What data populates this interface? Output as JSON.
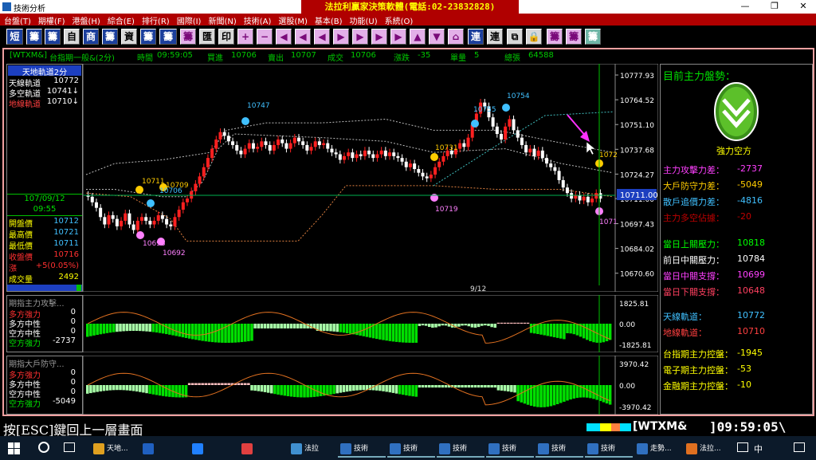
{
  "window": {
    "title": "技術分析",
    "banner": "法拉利贏家決策軟體(電話:02-23832828)",
    "min": "—",
    "restore": "❐",
    "close": "✕"
  },
  "menu": [
    "台盤(T)",
    "期權(F)",
    "港盤(H)",
    "綜合(E)",
    "排行(R)",
    "國際(I)",
    "新聞(N)",
    "技術(A)",
    "選股(M)",
    "基本(B)",
    "功能(U)",
    "系統(O)"
  ],
  "toolbar": {
    "buttons": [
      {
        "label": "短",
        "style": "b"
      },
      {
        "label": "籌",
        "style": "b"
      },
      {
        "label": "籌",
        "style": "b"
      },
      {
        "label": "自",
        "style": ""
      },
      {
        "label": "商",
        "style": "b"
      },
      {
        "label": "籌",
        "style": "b"
      },
      {
        "label": "資",
        "style": ""
      },
      {
        "label": "籌",
        "style": "b"
      },
      {
        "label": "籌",
        "style": "b"
      },
      {
        "label": "籌",
        "style": "p"
      },
      {
        "label": "匯",
        "style": ""
      },
      {
        "label": "印",
        "style": ""
      },
      {
        "label": "+",
        "style": "p"
      },
      {
        "label": "−",
        "style": "p"
      },
      {
        "label": "◀",
        "style": "p"
      },
      {
        "label": "◀",
        "style": "p"
      },
      {
        "label": "◀",
        "style": "p"
      },
      {
        "label": "▶",
        "style": "p"
      },
      {
        "label": "▶",
        "style": "p"
      },
      {
        "label": "▶",
        "style": "p"
      },
      {
        "label": "▶",
        "style": "p"
      },
      {
        "label": "▲",
        "style": "p"
      },
      {
        "label": "▼",
        "style": "p"
      },
      {
        "label": "⌂",
        "style": "p"
      },
      {
        "label": "連",
        "style": "b"
      },
      {
        "label": "連",
        "style": ""
      },
      {
        "label": "⧉",
        "style": ""
      },
      {
        "label": "🔒",
        "style": ""
      },
      {
        "label": "籌",
        "style": "p"
      },
      {
        "label": "籌",
        "style": "p"
      },
      {
        "label": "籌",
        "style": "t"
      }
    ]
  },
  "infobar": {
    "symbol": "[WTXM&]",
    "contract": "台指期一般&(2分)",
    "time_label": "時間",
    "time": "09:59:05",
    "bid_label": "買進",
    "bid": "10706",
    "ask_label": "賣出",
    "ask": "10707",
    "deal_label": "成交",
    "deal": "10706",
    "change_label": "漲跌",
    "change": "-35",
    "vol_label": "單量",
    "vol": "5",
    "total_label": "總張",
    "total": "64588"
  },
  "left_panel": {
    "header": "天地軌道2分",
    "tracks": [
      {
        "label": "天線軌道",
        "value": "10772",
        "color": "#ffffff"
      },
      {
        "label": "多空軌道",
        "value": "10741↓",
        "color": "#ffffff"
      },
      {
        "label": "地線軌道",
        "value": "10710↓",
        "color": "#ff4040"
      }
    ],
    "date": "107/09/12",
    "time": "09:55",
    "stats": [
      {
        "label": "開盤價",
        "value": "10712",
        "color": "#ffff00"
      },
      {
        "label": "最高價",
        "value": "10721",
        "color": "#ffff00"
      },
      {
        "label": "最低價",
        "value": "10711",
        "color": "#ffff00"
      },
      {
        "label": "收盤價",
        "value": "10716",
        "color": "#ff3030"
      },
      {
        "label": "漲",
        "value": "+5(0.05%)",
        "color": "#ff3030"
      },
      {
        "label": "成交量",
        "value": "2492",
        "color": "#ffff00"
      }
    ]
  },
  "price_chart": {
    "yticks": [
      "10777.93",
      "10764.52",
      "10751.10",
      "10737.68",
      "10724.27",
      "10711.00",
      "10697.43",
      "10684.02",
      "10670.60"
    ],
    "current_price": "10711.00",
    "date_marker": "9/12",
    "markers": [
      {
        "label": "10747",
        "color": "#40c0ff"
      },
      {
        "label": "10711",
        "color": "#ffcc00"
      },
      {
        "label": "10709",
        "color": "#ffcc00"
      },
      {
        "label": "10706",
        "color": "#40c0ff"
      },
      {
        "label": "10693",
        "color": "#ff80ff"
      },
      {
        "label": "10692",
        "color": "#ff80ff"
      },
      {
        "label": "10719",
        "color": "#ff80ff"
      },
      {
        "label": "10731",
        "color": "#ffcc00"
      },
      {
        "label": "10755",
        "color": "#40c0ff"
      },
      {
        "label": "10754",
        "color": "#40c0ff"
      },
      {
        "label": "1072",
        "color": "#ffcc00"
      },
      {
        "label": "1071",
        "color": "#ff80ff"
      }
    ]
  },
  "osc1": {
    "title": "期指主力攻擊...",
    "rows": [
      {
        "label": "多方強力",
        "value": "0",
        "color": "#ff3030"
      },
      {
        "label": "多方中性",
        "value": "0",
        "color": "#ffffff"
      },
      {
        "label": "空方中性",
        "value": "0",
        "color": "#ffffff"
      },
      {
        "label": "空方強力",
        "value": "-2737",
        "color": "#00e000"
      }
    ],
    "yticks": [
      "1825.81",
      "0.00",
      "-1825.81"
    ]
  },
  "osc2": {
    "title": "期指大戶防守...",
    "rows": [
      {
        "label": "多方強力",
        "value": "0",
        "color": "#ff3030"
      },
      {
        "label": "多方中性",
        "value": "0",
        "color": "#ffffff"
      },
      {
        "label": "空方中性",
        "value": "0",
        "color": "#ffffff"
      },
      {
        "label": "空方強力",
        "value": "-5049",
        "color": "#00e000"
      }
    ],
    "yticks": [
      "3970.42",
      "0.00",
      "-3970.42"
    ]
  },
  "right_panel": {
    "title": "目前主力盤勢：",
    "trend": "強力空方",
    "diffs": [
      {
        "label": "主力攻擊力差：",
        "value": "-2737",
        "color": "#ff40ff"
      },
      {
        "label": "大戶防守力差：",
        "value": "-5049",
        "color": "#ffcc00"
      },
      {
        "label": "散戶追價力差：",
        "value": "-4816",
        "color": "#40c0ff"
      },
      {
        "label": "主力多空佔據：",
        "value": "-20",
        "color": "#c00000"
      }
    ],
    "levels": [
      {
        "label": "當日上關壓力：",
        "value": "10818",
        "color": "#00ff00"
      },
      {
        "label": "前日中關壓力：",
        "value": "10784",
        "color": "#ffffff"
      },
      {
        "label": "當日中關支撐：",
        "value": "10699",
        "color": "#ff40ff"
      },
      {
        "label": "當日下關支撐：",
        "value": "10648",
        "color": "#ff4060"
      }
    ],
    "tracks": [
      {
        "label": "天線軌道：",
        "value": "10772",
        "color": "#40c0ff"
      },
      {
        "label": "地線軌道：",
        "value": "10710",
        "color": "#ff4040"
      }
    ],
    "futures": [
      {
        "label": "台指期主力控盤：",
        "value": "-1945",
        "color": "#ffff00"
      },
      {
        "label": "電子期主力控盤：",
        "value": "-53",
        "color": "#ffff00"
      },
      {
        "label": "金融期主力控盤：",
        "value": "-10",
        "color": "#ffff00"
      }
    ]
  },
  "status": {
    "hint": "按[ESC]鍵回上一層畫面",
    "symbol": "[WTXM&",
    "clock": "]09:59:05\\"
  },
  "taskbar": {
    "tasks": [
      "天地...",
      "",
      "",
      "",
      "法拉",
      "技術",
      "技術",
      "技術",
      "技術",
      "技術",
      "技術",
      "走勢...",
      "法拉..."
    ],
    "tray": "中"
  }
}
